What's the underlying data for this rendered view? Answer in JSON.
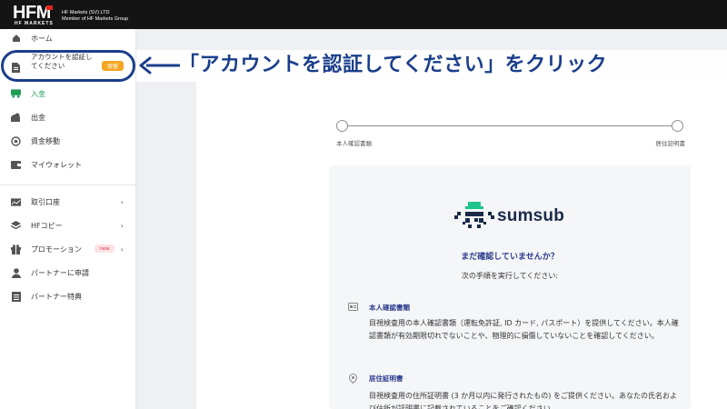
{
  "header": {
    "logo_text": "HFM",
    "logo_sub": "HF MARKETS",
    "company_line1": "HF Markets (SV) LTD",
    "company_line2": "Member of HF Markets Group"
  },
  "sidebar": {
    "items": [
      {
        "label": "ホーム",
        "icon": "home-icon"
      },
      {
        "label": "アカウントを認証してください",
        "badge": "保留",
        "icon": "document-icon"
      },
      {
        "label": "入金",
        "icon": "deposit-icon",
        "color": "#1f9d55"
      },
      {
        "label": "出金",
        "icon": "withdraw-icon"
      },
      {
        "label": "資金移動",
        "icon": "transfer-icon"
      },
      {
        "label": "マイウォレット",
        "icon": "wallet-icon"
      },
      {
        "label": "取引口座",
        "icon": "chart-icon",
        "chevron": "›"
      },
      {
        "label": "HFコピー",
        "icon": "layers-icon",
        "chevron": "›"
      },
      {
        "label": "プロモーション",
        "badge": "new",
        "icon": "gift-icon",
        "chevron": "›"
      },
      {
        "label": "パートナーに申請",
        "icon": "user-icon"
      },
      {
        "label": "パートナー特典",
        "icon": "list-icon"
      }
    ],
    "verify_line1": "アカウントを認証し",
    "verify_line2": "てください"
  },
  "annotation": {
    "text": "「アカウントを認証してください」をクリック",
    "color": "#1a3e8c"
  },
  "stepper": {
    "step1": "本人確認書類",
    "step2": "居住証明書"
  },
  "sumsub": {
    "brand": "sumsub",
    "title": "まだ確認していませんか？",
    "subtitle": "次の手順を実行してください:",
    "section1_title": "本人確認書類",
    "section1_body": "目視検査用の本人確認書類（運転免許証, ID カード, パスポート）を提供してください。本人確認書類が有効期限切れでないことや、物理的に損傷していないことを確認してください。",
    "section2_title": "居住証明書",
    "section2_body": "目視検査用の住所証明書 (3 か月以内に発行されたもの) をご提供ください。あなたの氏名および住所が証明書に記載されていることをご確認ください。"
  }
}
